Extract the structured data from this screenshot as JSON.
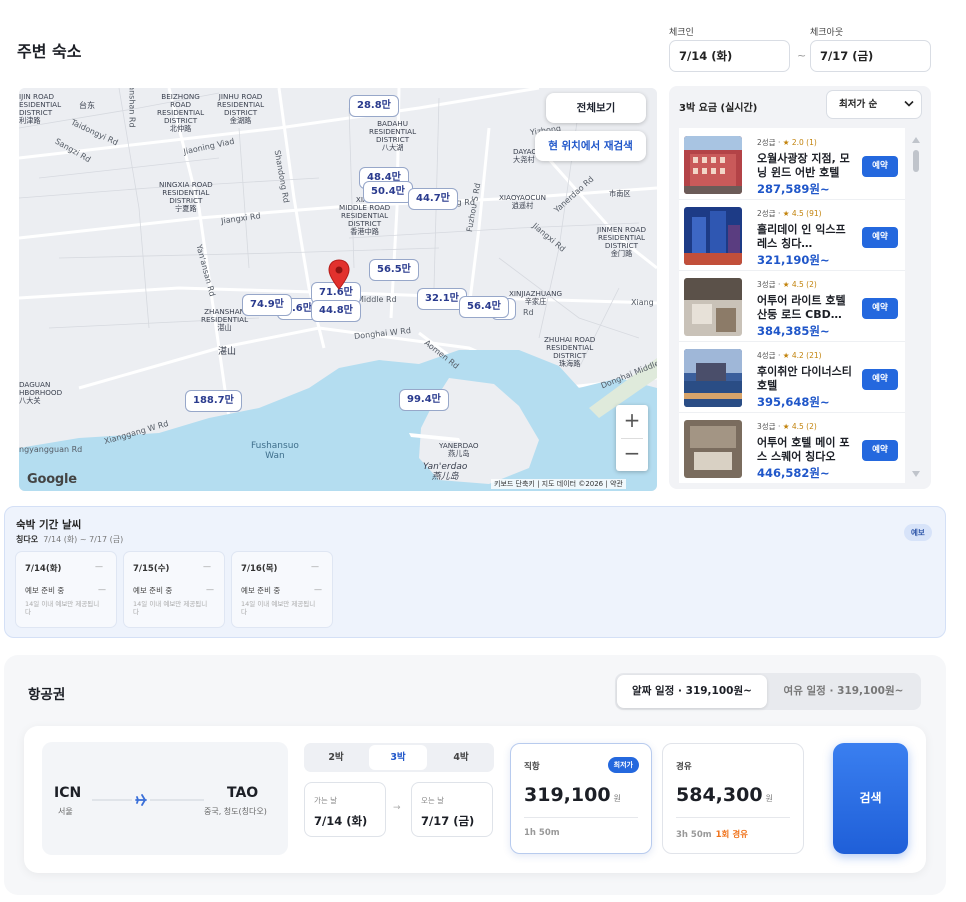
{
  "header": {
    "title": "주변 숙소",
    "checkin_label": "체크인",
    "checkin_value": "7/14 (화)",
    "checkout_label": "체크아웃",
    "checkout_value": "7/17 (금)",
    "separator": "~"
  },
  "map": {
    "full_view_button": "전체보기",
    "research_button": "현 위치에서 재검색",
    "price_pins": [
      "28.8만",
      "48.4만",
      "50.4만",
      "44.7만",
      "56.5만",
      "71.6만",
      "44.8만",
      "74.9만",
      "8.6만",
      "32.1만",
      "56.4만",
      "만",
      "188.7만",
      "99.4만"
    ],
    "district_labels": [
      "IJIN ROAD\nESIDENTIAL\nDISTRICT\n利津路",
      "台东",
      "BEIZHONG\nROAD\nRESIDENTIAL\nDISTRICT\n北仲路",
      "JINHU ROAD\nRESIDENTIAL\nDISTRICT\n金湖路",
      "BADAHU\nRESIDENTIAL\nDISTRICT\n八大湖",
      "NINGXIA ROAD\nRESIDENTIAL\nDISTRICT\n宁夏路",
      "XIAN\nMIDDLE ROAD\nRESIDENTIAL\nDISTRICT\n香港中路",
      "DAYAO\n大尧村",
      "XIAOYAOCUN\n逍遥村",
      "市南区",
      "JINMEN ROAD\nRESIDENTIAL\nDISTRICT\n金门路",
      "XINJIAZHUANG\n辛家庄",
      "ZHANSHAN\nRESIDENTIAL\n湛山",
      "湛山",
      "ZHUHAI ROAD\nRESIDENTIAL\nDISTRICT\n珠海路",
      "DAGUAN\nHBORHOOD\n八大关",
      "Fushansuo\nWan",
      "YANERDAO\n燕儿岛",
      "Yan'erdao\n燕儿岛"
    ],
    "road_labels": [
      "Taidongyi Rd",
      "Sangzi Rd",
      "Jiaoning Viad",
      "Yanshan Rd",
      "Shandong Rd",
      "Jiangxi Rd",
      "Yan'ansan Rd",
      "Fuzhou S Rd",
      "Yanerdao Rd",
      "Jiangxi Rd",
      "Middle Rd",
      "Donghai W Rd",
      "Aomen Rd",
      "Rd",
      "Xiang",
      "Donghai Middle",
      "Xianggang W Rd",
      "ngyangguan Rd",
      "Yizhong",
      "Xiang Rd"
    ],
    "zoom_in": "+",
    "zoom_out": "−",
    "google": "Google",
    "attribution": "키보드 단축키 | 지도 데이터 ©2026 | 약관"
  },
  "hotel_panel": {
    "title": "3박 요금 (실시간)",
    "sort_value": "최저가 순",
    "book_label": "예약",
    "hotels": [
      {
        "grade": "2성급 · ",
        "rating": "★ 2.0 (1)",
        "name": "오월사광장 지점, 모닝 윈드 어반 호텔",
        "price": "287,589원~"
      },
      {
        "grade": "2성급 · ",
        "rating": "★ 4.5 (91)",
        "name": "홀리데이 인 익스프레스 칭다…",
        "price": "321,190원~"
      },
      {
        "grade": "3성급 · ",
        "rating": "★ 4.5 (2)",
        "name": "어투어 라이트 호텔 산둥 로드 CBD…",
        "price": "384,385원~"
      },
      {
        "grade": "4성급 · ",
        "rating": "★ 4.2 (21)",
        "name": "후이취안 다이너스티 호텔",
        "price": "395,648원~"
      },
      {
        "grade": "3성급 · ",
        "rating": "★ 4.5 (2)",
        "name": "어투어 호텔 메이 포스 스퀘어 칭다오",
        "price": "446,582원~"
      }
    ]
  },
  "weather": {
    "title": "숙박 기간 날씨",
    "city": "칭다오",
    "range": "7/14 (화) ~ 7/17 (금)",
    "badge": "예보",
    "days": [
      {
        "date": "7/14(화)",
        "dash": "—",
        "status": "예보 준비 중",
        "dash2": "—",
        "note": "14일 이내 예보만 제공됩니다"
      },
      {
        "date": "7/15(수)",
        "dash": "—",
        "status": "예보 준비 중",
        "dash2": "—",
        "note": "14일 이내 예보만 제공됩니다"
      },
      {
        "date": "7/16(목)",
        "dash": "—",
        "status": "예보 준비 중",
        "dash2": "—",
        "note": "14일 이내 예보만 제공됩니다"
      }
    ]
  },
  "flights": {
    "title": "항공권",
    "toggle_on": "알짜 일정 · 319,100원~",
    "toggle_off": "여유 일정 · 319,100원~",
    "origin_code": "ICN",
    "origin_city": "서울",
    "dest_code": "TAO",
    "dest_city": "중국, 청도(칭다오)",
    "nights": [
      "2박",
      "3박",
      "4박"
    ],
    "depart_label": "가는 날",
    "depart_value": "7/14 (화)",
    "return_label": "오는 날",
    "return_value": "7/17 (금)",
    "arrow": "→",
    "direct": {
      "label": "직항",
      "badge": "최저가",
      "price": "319,100",
      "unit": "원",
      "duration": "1h 50m"
    },
    "transfer": {
      "label": "경유",
      "price": "584,300",
      "unit": "원",
      "duration": "3h 50m",
      "stops": "1회 경유"
    },
    "search": "검색"
  },
  "colors": {
    "accent": "#2468de",
    "price_blue": "#1f56c9",
    "water": "#b4ddf0",
    "transfer_orange": "#f0731b"
  }
}
